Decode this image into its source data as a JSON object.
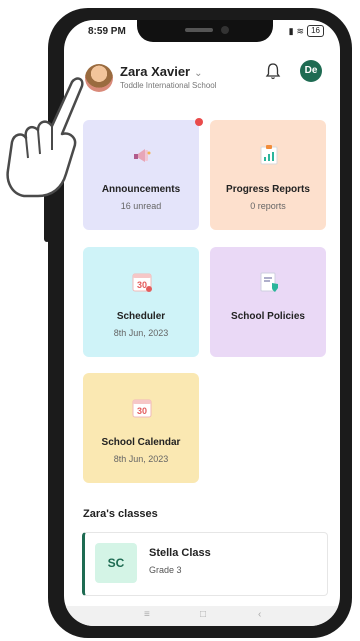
{
  "status_bar": {
    "time": "8:59 PM",
    "battery": "16"
  },
  "header": {
    "user_name": "Zara Xavier",
    "school_name": "Toddle International School",
    "initials": "De"
  },
  "tiles": [
    {
      "title": "Announcements",
      "subtitle": "16 unread",
      "icon": "megaphone-icon",
      "color": "#e4e4fa"
    },
    {
      "title": "Progress Reports",
      "subtitle": "0 reports",
      "icon": "report-chart-icon",
      "color": "#fde0cd"
    },
    {
      "title": "Scheduler",
      "subtitle": "8th Jun, 2023",
      "icon": "calendar-icon",
      "date_number": "30",
      "color": "#cff3f8"
    },
    {
      "title": "School Policies",
      "subtitle": "",
      "icon": "policy-document-icon",
      "color": "#ead9f6"
    },
    {
      "title": "School Calendar",
      "subtitle": "8th Jun, 2023",
      "icon": "calendar-icon",
      "date_number": "30",
      "color": "#fae8b2"
    }
  ],
  "classes": {
    "heading": "Zara's classes",
    "items": [
      {
        "abbr": "SC",
        "name": "Stella Class",
        "grade": "Grade 3"
      }
    ]
  },
  "nav_bar": {
    "menu": "≡",
    "home": "□",
    "back": "‹"
  },
  "colors": {
    "accent": "#1e6b52",
    "notification_dot": "#e94b4b"
  }
}
